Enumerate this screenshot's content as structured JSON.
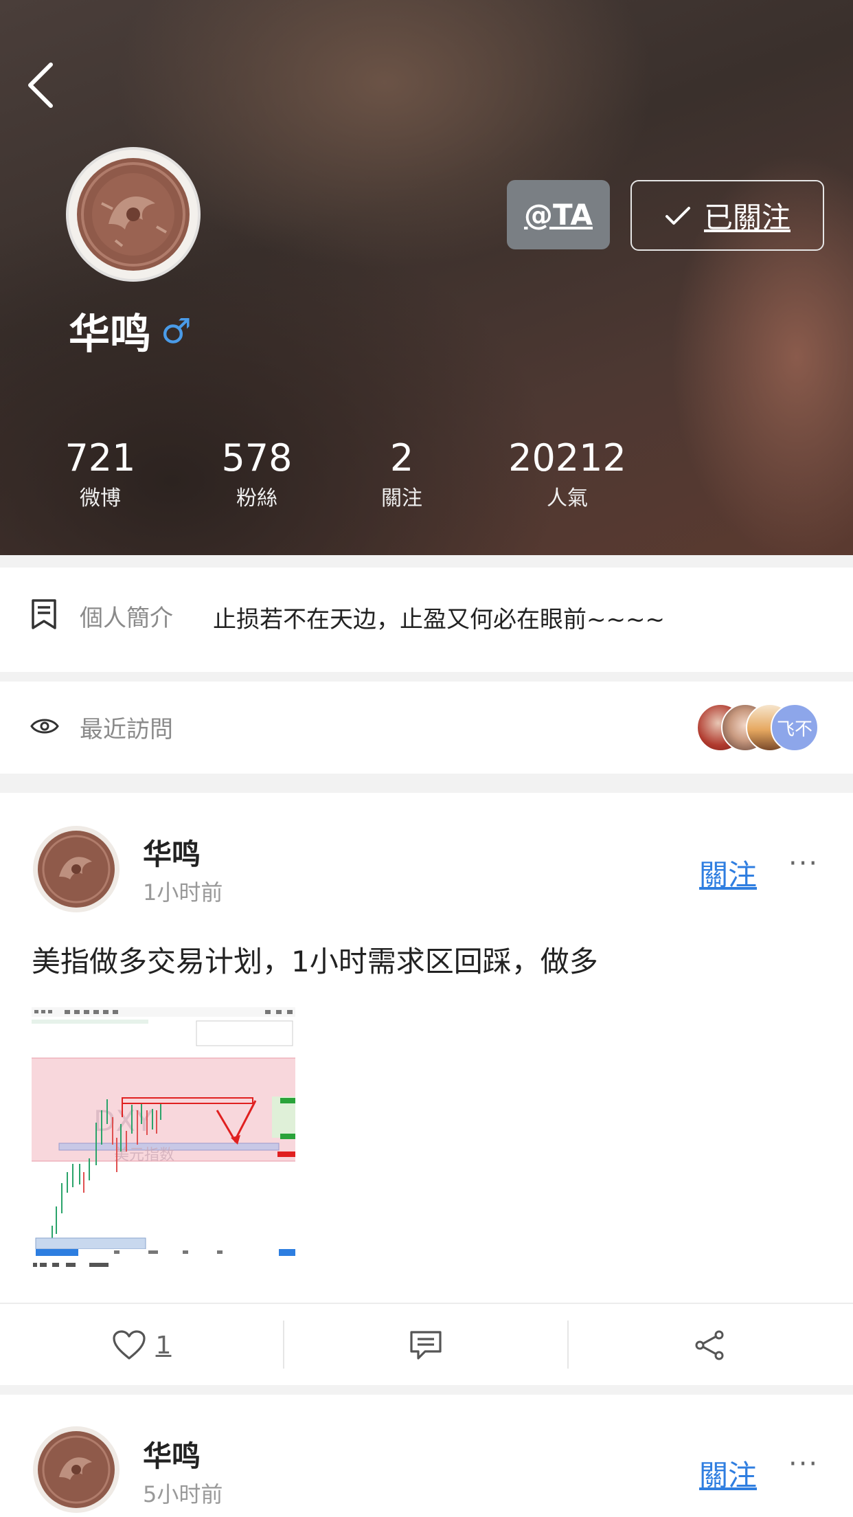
{
  "header": {
    "at_button": "@TA",
    "followed_button": "已關注",
    "name": "华鸣",
    "gender_symbol": "♂",
    "gender_color": "#4a9be8",
    "stats": [
      {
        "value": "721",
        "label": "微博"
      },
      {
        "value": "578",
        "label": "粉絲"
      },
      {
        "value": "2",
        "label": "關注"
      },
      {
        "value": "20212",
        "label": "人氣"
      }
    ]
  },
  "intro": {
    "label": "個人簡介",
    "text": "止损若不在天边，止盈又何必在眼前~~~~"
  },
  "recent_visits": {
    "label": "最近訪問",
    "last_visitor_text": "飞不"
  },
  "posts": [
    {
      "author": "华鸣",
      "time": "1小时前",
      "follow_label": "關注",
      "more": "···",
      "text": "美指做多交易计划，1小时需求区回踩，做多",
      "image_alt_texts": [
        "DXY",
        "美元指数"
      ],
      "like_count": "1"
    },
    {
      "author": "华鸣",
      "time": "5小时前",
      "follow_label": "關注",
      "more": "···"
    }
  ],
  "colors": {
    "accent": "#2f7ee0",
    "at_button_bg": "#7a7f84"
  }
}
